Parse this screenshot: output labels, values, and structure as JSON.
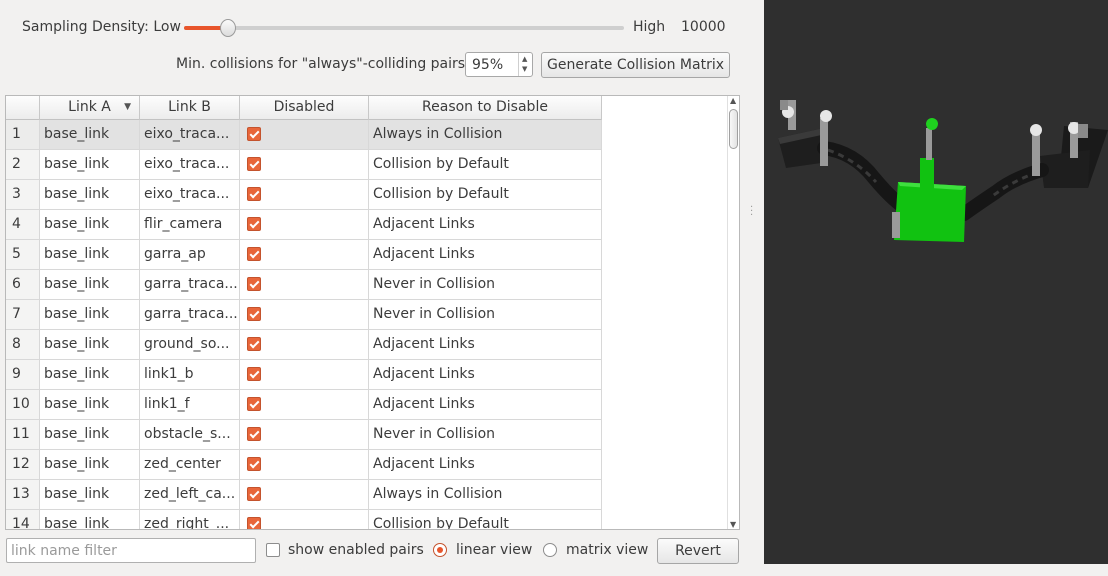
{
  "sampling": {
    "label": "Sampling Density: Low",
    "high_label": "High",
    "value": "10000",
    "slider_fraction": 0.1
  },
  "min_collisions": {
    "label": "Min. collisions for \"always\"-colliding pairs:",
    "value": "95%"
  },
  "generate_button": "Generate Collision Matrix",
  "table": {
    "columns": [
      "Link A",
      "Link B",
      "Disabled",
      "Reason to Disable"
    ],
    "rows": [
      {
        "n": "1",
        "a": "base_link",
        "b": "eixo_traca...",
        "reason": "Always in Collision"
      },
      {
        "n": "2",
        "a": "base_link",
        "b": "eixo_traca...",
        "reason": "Collision by Default"
      },
      {
        "n": "3",
        "a": "base_link",
        "b": "eixo_traca...",
        "reason": "Collision by Default"
      },
      {
        "n": "4",
        "a": "base_link",
        "b": "flir_camera",
        "reason": "Adjacent Links"
      },
      {
        "n": "5",
        "a": "base_link",
        "b": "garra_ap",
        "reason": "Adjacent Links"
      },
      {
        "n": "6",
        "a": "base_link",
        "b": "garra_traca...",
        "reason": "Never in Collision"
      },
      {
        "n": "7",
        "a": "base_link",
        "b": "garra_traca...",
        "reason": "Never in Collision"
      },
      {
        "n": "8",
        "a": "base_link",
        "b": "ground_so...",
        "reason": "Adjacent Links"
      },
      {
        "n": "9",
        "a": "base_link",
        "b": "link1_b",
        "reason": "Adjacent Links"
      },
      {
        "n": "10",
        "a": "base_link",
        "b": "link1_f",
        "reason": "Adjacent Links"
      },
      {
        "n": "11",
        "a": "base_link",
        "b": "obstacle_s...",
        "reason": "Never in Collision"
      },
      {
        "n": "12",
        "a": "base_link",
        "b": "zed_center",
        "reason": "Adjacent Links"
      },
      {
        "n": "13",
        "a": "base_link",
        "b": "zed_left_ca...",
        "reason": "Always in Collision"
      },
      {
        "n": "14",
        "a": "base_link",
        "b": "zed_right_...",
        "reason": "Collision by Default"
      }
    ]
  },
  "filter": {
    "placeholder": "link name filter",
    "value": ""
  },
  "show_enabled_label": "show enabled pairs",
  "view_modes": {
    "linear": "linear view",
    "matrix": "matrix view",
    "selected": "linear"
  },
  "revert_button": "Revert",
  "colors": {
    "accent": "#e8552b",
    "viewport_bg": "#2f2f2f",
    "robot_body": "#11c211"
  }
}
